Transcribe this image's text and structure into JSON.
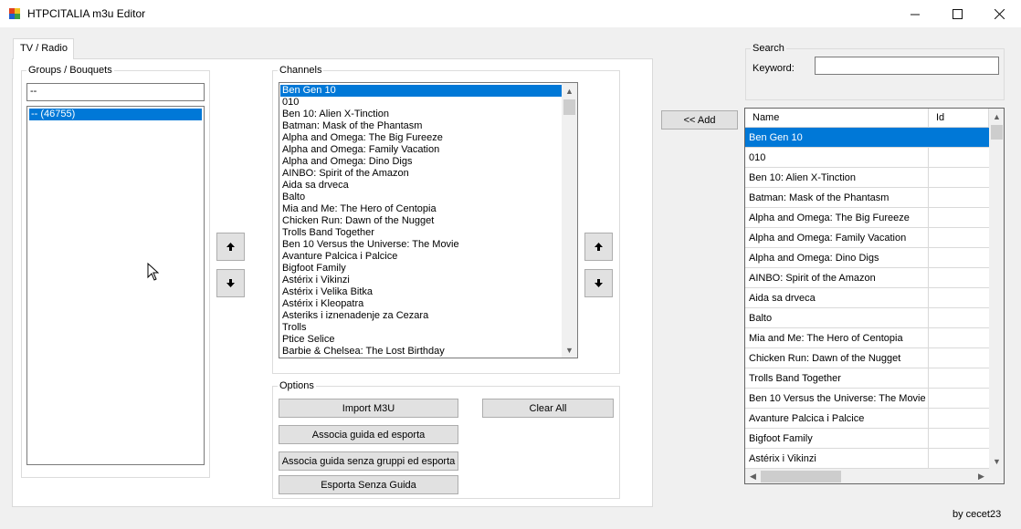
{
  "window": {
    "title": "HTPCITALIA m3u Editor"
  },
  "tabs": [
    {
      "label": "TV / Radio"
    }
  ],
  "groups": {
    "legend": "Groups / Bouquets",
    "filter_value": "--",
    "items": [
      "-- (46755)"
    ],
    "selected_index": 0
  },
  "channels": {
    "legend": "Channels",
    "selected_index": 0,
    "items": [
      "Ben Gen 10",
      "010",
      "Ben 10: Alien X-Tinction",
      "Batman: Mask of the Phantasm",
      "Alpha and Omega: The Big Fureeze",
      "Alpha and Omega: Family Vacation",
      "Alpha and Omega: Dino Digs",
      "AINBO: Spirit of the Amazon",
      "Aida sa drveca",
      "Balto",
      "Mia and Me: The Hero of Centopia",
      "Chicken Run: Dawn of the Nugget",
      "Trolls Band Together",
      "Ben 10 Versus the Universe: The Movie",
      "Avanture Palcica i Palcice",
      "Bigfoot Family",
      "Astérix i Vikinzi",
      "Astérix i Velika Bitka",
      "Astérix i  Kleopatra",
      "Asteriks i iznenadenje za Cezara",
      "Trolls",
      "Ptice Selice",
      "Barbie & Chelsea: The Lost Birthday"
    ]
  },
  "options": {
    "legend": "Options",
    "import_label": "Import M3U",
    "clear_label": "Clear All",
    "export_guide_label": "Associa guida ed esporta",
    "export_guide_nogroups_label": "Associa guida senza gruppi ed esporta",
    "export_noguide_label": "Esporta Senza Guida"
  },
  "search": {
    "legend": "Search",
    "keyword_label": "Keyword:",
    "keyword_value": ""
  },
  "add_label": "<< Add",
  "grid": {
    "columns": [
      "Name",
      "Id"
    ],
    "selected_index": 0,
    "rows": [
      "Ben Gen 10",
      "010",
      "Ben 10: Alien X-Tinction",
      "Batman: Mask of the Phantasm",
      "Alpha and Omega: The Big Fureeze",
      "Alpha and Omega: Family Vacation",
      "Alpha and Omega: Dino Digs",
      "AINBO: Spirit of the Amazon",
      "Aida sa drveca",
      "Balto",
      "Mia and Me: The Hero of Centopia",
      "Chicken Run: Dawn of the Nugget",
      "Trolls Band Together",
      "Ben 10 Versus the Universe: The Movie",
      "Avanture Palcica i Palcice",
      "Bigfoot Family",
      "Astérix i Vikinzi"
    ]
  },
  "footer": {
    "credit": "by cecet23"
  },
  "icons": {
    "app": "app-icon",
    "minimize": "minimize-icon",
    "maximize": "maximize-icon",
    "close": "close-icon",
    "up": "arrow-up-icon",
    "down": "arrow-down-icon"
  },
  "colors": {
    "selection": "#0078d7",
    "window_bg": "#f0f0f0"
  }
}
